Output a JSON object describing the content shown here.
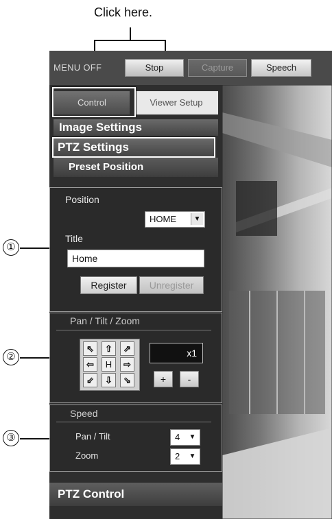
{
  "annotation": {
    "callout": "Click here.",
    "markers": [
      "①",
      "②",
      "③"
    ]
  },
  "menubar": {
    "menu_off": "MENU  OFF",
    "buttons": {
      "stop": "Stop",
      "capture": "Capture",
      "speech": "Speech"
    }
  },
  "tabs": {
    "control": "Control",
    "viewer_setup": "Viewer Setup"
  },
  "sections": {
    "image_settings": "Image Settings",
    "ptz_settings": "PTZ Settings",
    "preset_position": "Preset Position",
    "ptz_control": "PTZ Control"
  },
  "preset": {
    "position_label": "Position",
    "position_value": "HOME",
    "title_label": "Title",
    "title_value": "Home",
    "register": "Register",
    "unregister": "Unregister"
  },
  "ptz": {
    "title": "Pan / Tilt / Zoom",
    "keys": [
      "⇖",
      "⇧",
      "⇗",
      "⇦",
      "H",
      "⇨",
      "⇙",
      "⇩",
      "⇘"
    ],
    "zoom_value": "x1",
    "zoom_in": "+",
    "zoom_out": "-"
  },
  "speed": {
    "title": "Speed",
    "pan_tilt_label": "Pan / Tilt",
    "pan_tilt_value": "4",
    "zoom_label": "Zoom",
    "zoom_value": "2"
  },
  "colors": {
    "panel_bg": "#2a2a2a",
    "highlight": "#ffffff",
    "screen_bg": "#3a3a3a"
  }
}
